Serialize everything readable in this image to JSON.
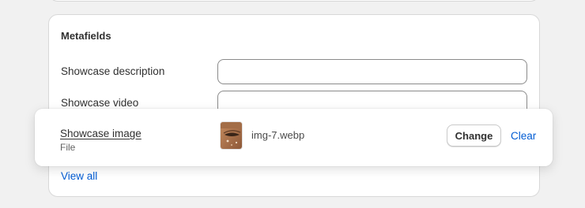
{
  "metafields": {
    "title": "Metafields",
    "rows": [
      {
        "label": "Showcase description",
        "value": ""
      },
      {
        "label": "Showcase video",
        "value": ""
      }
    ],
    "view_all": "View all"
  },
  "image_row": {
    "label": "Showcase image",
    "type": "File",
    "file_name": "img-7.webp",
    "change_label": "Change",
    "clear_label": "Clear"
  }
}
